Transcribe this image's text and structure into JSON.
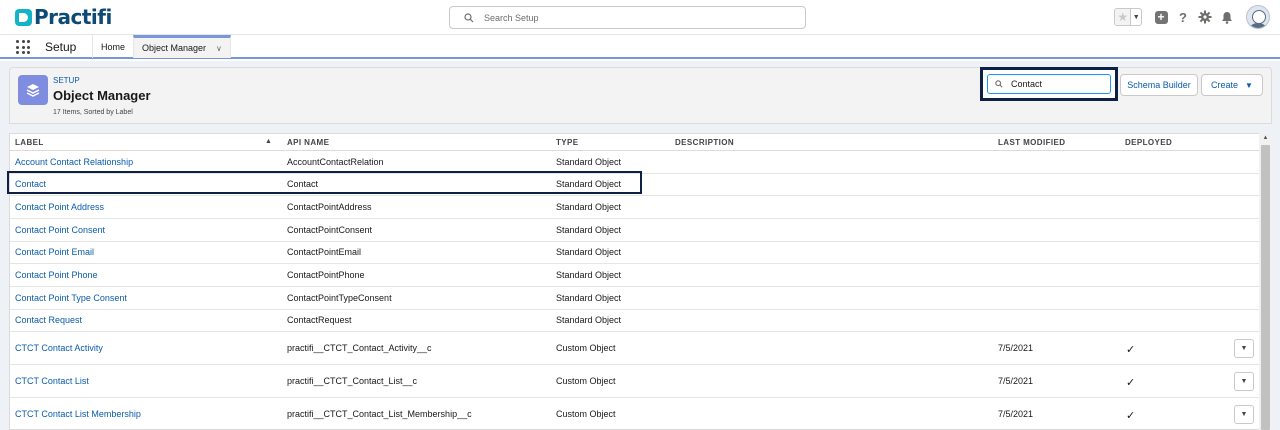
{
  "brand": {
    "logo_text": "Practifi",
    "logo_color": "#0d4a75",
    "mark_color": "#14b4c8"
  },
  "global_search": {
    "placeholder": "Search Setup"
  },
  "header_icons": [
    "favorites-star-icon",
    "favorites-dropdown-icon",
    "global-actions-plus-icon",
    "help-icon",
    "setup-gear-icon",
    "notifications-bell-icon",
    "user-avatar"
  ],
  "nav": {
    "app_name": "Setup",
    "tabs": [
      {
        "label": "Home"
      },
      {
        "label": "Object Manager",
        "active": true
      }
    ]
  },
  "page_header": {
    "breadcrumb": "SETUP",
    "title": "Object Manager",
    "subtitle": "17 Items, Sorted by Label"
  },
  "quick_find": {
    "value": "Contact"
  },
  "buttons": {
    "schema_builder": "Schema Builder",
    "create": "Create"
  },
  "table": {
    "columns": {
      "label": "LABEL",
      "api_name": "API NAME",
      "type": "TYPE",
      "description": "DESCRIPTION",
      "last_modified": "LAST MODIFIED",
      "deployed": "DEPLOYED"
    },
    "rows": [
      {
        "label": "Account Contact Relationship",
        "api_name": "AccountContactRelation",
        "type": "Standard Object",
        "last_modified": "",
        "deployed": ""
      },
      {
        "label": "Contact",
        "api_name": "Contact",
        "type": "Standard Object",
        "last_modified": "",
        "deployed": ""
      },
      {
        "label": "Contact Point Address",
        "api_name": "ContactPointAddress",
        "type": "Standard Object",
        "last_modified": "",
        "deployed": ""
      },
      {
        "label": "Contact Point Consent",
        "api_name": "ContactPointConsent",
        "type": "Standard Object",
        "last_modified": "",
        "deployed": ""
      },
      {
        "label": "Contact Point Email",
        "api_name": "ContactPointEmail",
        "type": "Standard Object",
        "last_modified": "",
        "deployed": ""
      },
      {
        "label": "Contact Point Phone",
        "api_name": "ContactPointPhone",
        "type": "Standard Object",
        "last_modified": "",
        "deployed": ""
      },
      {
        "label": "Contact Point Type Consent",
        "api_name": "ContactPointTypeConsent",
        "type": "Standard Object",
        "last_modified": "",
        "deployed": ""
      },
      {
        "label": "Contact Request",
        "api_name": "ContactRequest",
        "type": "Standard Object",
        "last_modified": "",
        "deployed": ""
      },
      {
        "label": "CTCT Contact Activity",
        "api_name": "practifi__CTCT_Contact_Activity__c",
        "type": "Custom Object",
        "last_modified": "7/5/2021",
        "deployed": "✓"
      },
      {
        "label": "CTCT Contact List",
        "api_name": "practifi__CTCT_Contact_List__c",
        "type": "Custom Object",
        "last_modified": "7/5/2021",
        "deployed": "✓"
      },
      {
        "label": "CTCT Contact List Membership",
        "api_name": "practifi__CTCT_Contact_List_Membership__c",
        "type": "Custom Object",
        "last_modified": "7/5/2021",
        "deployed": "✓"
      }
    ]
  }
}
